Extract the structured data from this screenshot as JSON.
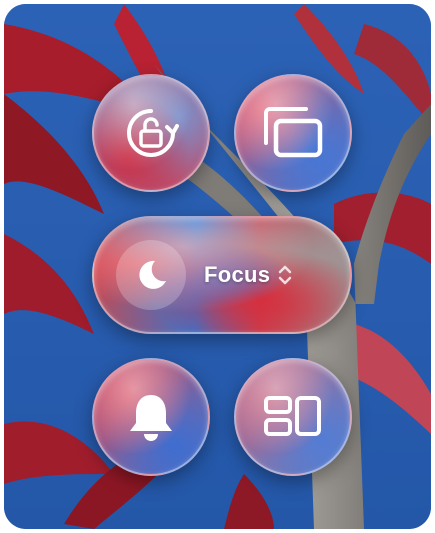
{
  "control_center": {
    "controls": {
      "rotation_lock": {
        "icon": "rotation-lock-icon",
        "state": "unlocked"
      },
      "screen_mirroring": {
        "icon": "screen-mirroring-icon"
      },
      "focus": {
        "label": "Focus",
        "icon": "moon-icon",
        "chevron_icon": "chevron-up-down-icon"
      },
      "alerts": {
        "icon": "bell-icon"
      },
      "stage_manager": {
        "icon": "stage-manager-icon"
      }
    }
  },
  "colors": {
    "sky": "#2a5fb0",
    "leaf_red": "#b8202f",
    "trunk": "#8d8a86",
    "icon": "#ffffff"
  }
}
